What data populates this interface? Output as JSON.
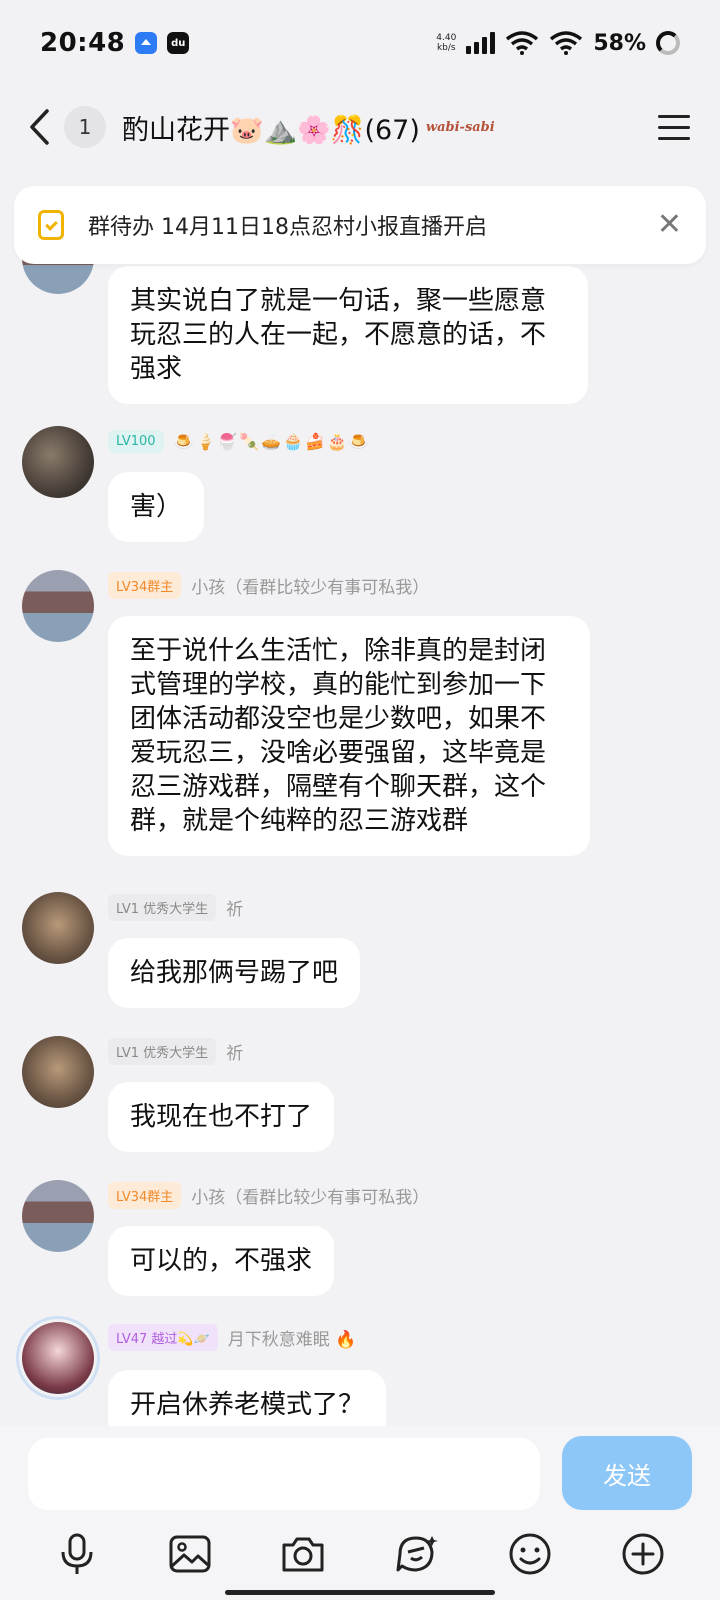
{
  "status_bar": {
    "time": "20:48",
    "net_speed_value": "4.40",
    "net_speed_unit": "kb/s",
    "battery": "58%"
  },
  "header": {
    "unread_count": "1",
    "group_name": "酌山花开🐷⛰️🌸🎊(67)",
    "group_name_extra": "wabi-sabi"
  },
  "todo_banner": {
    "text": "群待办 14月11日18点忍村小报直播开启"
  },
  "messages": [
    {
      "avatar": "building-avatar",
      "bubble": "其实说白了就是一句话，聚一些愿意玩忍三的人在一起，不愿意的话，不强求"
    },
    {
      "avatar": "dark-avatar",
      "level": "LV100",
      "decorations": "🍮🍦🍧🍡🥧🧁🍰🎂🍮",
      "bubble": "害）"
    },
    {
      "avatar": "building-avatar",
      "level": "LV34群主",
      "nickname": "小孩（看群比较少有事可私我）",
      "bubble": "至于说什么生活忙，除非真的是封闭式管理的学校，真的能忙到参加一下团体活动都没空也是少数吧，如果不爱玩忍三，没啥必要强留，这毕竟是忍三游戏群，隔壁有个聊天群，这个群，就是个纯粹的忍三游戏群"
    },
    {
      "avatar": "cat-avatar",
      "level": "LV1 优秀大学生",
      "nickname": "祈",
      "bubble": "给我那俩号踢了吧"
    },
    {
      "avatar": "cat-avatar",
      "level": "LV1 优秀大学生",
      "nickname": "祈",
      "bubble": "我现在也不打了"
    },
    {
      "avatar": "building-avatar",
      "level": "LV34群主",
      "nickname": "小孩（看群比较少有事可私我）",
      "bubble": "可以的，不强求"
    },
    {
      "avatar": "anime-avatar",
      "level": "LV47 越过💫🪐",
      "nickname": "月下秋意难眠 🔥",
      "bubble": "开启休养老模式了？"
    }
  ],
  "input_bar": {
    "placeholder": "",
    "send_label": "发送"
  },
  "colors": {
    "send_button": "#8cc7f7",
    "owner_tag": "#f08a2a",
    "level100_tag": "#2ab5a5",
    "todo_icon": "#f0b400"
  }
}
